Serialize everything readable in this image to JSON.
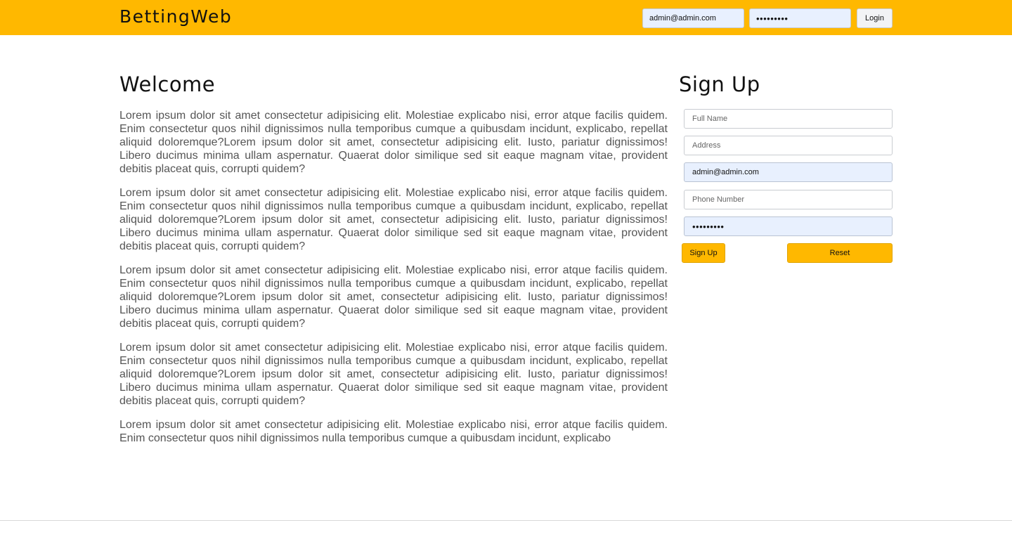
{
  "navbar": {
    "brand": "BettingWeb",
    "login_email_value": "admin@admin.com",
    "login_password_value": "•••••••••",
    "login_label": "Login"
  },
  "main": {
    "title": "Welcome",
    "paragraphs": [
      "Lorem ipsum dolor sit amet consectetur adipisicing elit. Molestiae explicabo nisi, error atque facilis quidem. Enim consectetur quos nihil dignissimos nulla temporibus cumque a quibusdam incidunt, explicabo, repellat aliquid doloremque?Lorem ipsum dolor sit amet, consectetur adipisicing elit. Iusto, pariatur dignissimos! Libero ducimus minima ullam aspernatur. Quaerat dolor similique sed sit eaque magnam vitae, provident debitis placeat quis, corrupti quidem?",
      "Lorem ipsum dolor sit amet consectetur adipisicing elit. Molestiae explicabo nisi, error atque facilis quidem. Enim consectetur quos nihil dignissimos nulla temporibus cumque a quibusdam incidunt, explicabo, repellat aliquid doloremque?Lorem ipsum dolor sit amet, consectetur adipisicing elit. Iusto, pariatur dignissimos! Libero ducimus minima ullam aspernatur. Quaerat dolor similique sed sit eaque magnam vitae, provident debitis placeat quis, corrupti quidem?",
      "Lorem ipsum dolor sit amet consectetur adipisicing elit. Molestiae explicabo nisi, error atque facilis quidem. Enim consectetur quos nihil dignissimos nulla temporibus cumque a quibusdam incidunt, explicabo, repellat aliquid doloremque?Lorem ipsum dolor sit amet, consectetur adipisicing elit. Iusto, pariatur dignissimos! Libero ducimus minima ullam aspernatur. Quaerat dolor similique sed sit eaque magnam vitae, provident debitis placeat quis, corrupti quidem?",
      "Lorem ipsum dolor sit amet consectetur adipisicing elit. Molestiae explicabo nisi, error atque facilis quidem. Enim consectetur quos nihil dignissimos nulla temporibus cumque a quibusdam incidunt, explicabo, repellat aliquid doloremque?Lorem ipsum dolor sit amet, consectetur adipisicing elit. Iusto, pariatur dignissimos! Libero ducimus minima ullam aspernatur. Quaerat dolor similique sed sit eaque magnam vitae, provident debitis placeat quis, corrupti quidem?",
      "Lorem ipsum dolor sit amet consectetur adipisicing elit. Molestiae explicabo nisi, error atque facilis quidem. Enim consectetur quos nihil dignissimos nulla temporibus cumque a quibusdam incidunt, explicabo"
    ]
  },
  "signup": {
    "title": "Sign Up",
    "full_name_placeholder": "Full Name",
    "address_placeholder": "Address",
    "email_value": "admin@admin.com",
    "phone_placeholder": "Phone Number",
    "password_value": "•••••••••",
    "submit_label": "Sign Up",
    "reset_label": "Reset"
  },
  "colors": {
    "accent": "#ffb800",
    "autofill": "#e8f0fe",
    "body_text": "#555555"
  }
}
